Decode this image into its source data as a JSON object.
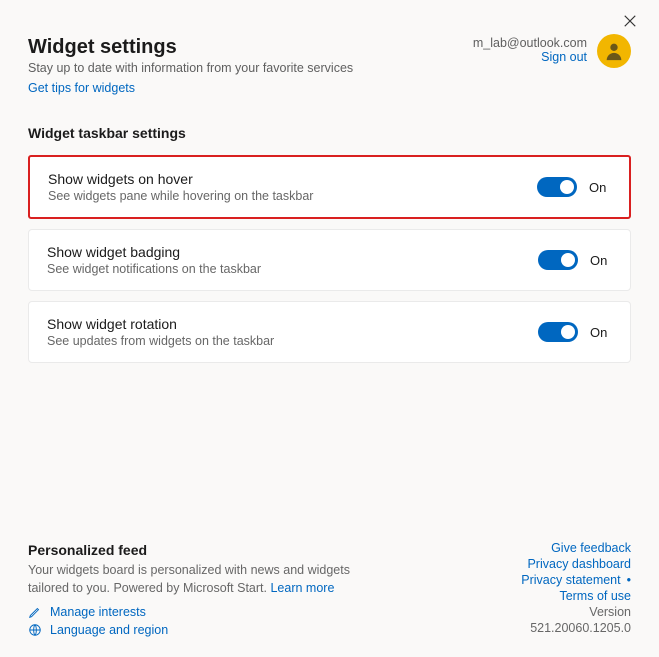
{
  "header": {
    "title": "Widget settings",
    "subtitle": "Stay up to date with information from your favorite services",
    "tips_link": "Get tips for widgets"
  },
  "account": {
    "email": "m_lab@outlook.com",
    "signout": "Sign out"
  },
  "section": {
    "title": "Widget taskbar settings",
    "items": [
      {
        "title": "Show widgets on hover",
        "desc": "See widgets pane while hovering on the taskbar",
        "state": "On"
      },
      {
        "title": "Show widget badging",
        "desc": "See widget notifications on the taskbar",
        "state": "On"
      },
      {
        "title": "Show widget rotation",
        "desc": "See updates from widgets on the taskbar",
        "state": "On"
      }
    ]
  },
  "footer": {
    "title": "Personalized feed",
    "desc": "Your widgets board is personalized with news and widgets tailored to you. Powered by Microsoft Start. ",
    "learn_more": "Learn more",
    "manage_interests": "Manage interests",
    "language_region": "Language and region"
  },
  "footer_right": {
    "feedback": "Give feedback",
    "privacy_dashboard": "Privacy dashboard",
    "privacy_statement": "Privacy statement",
    "terms": "Terms of use",
    "version_label": "Version",
    "version_num": "521.20060.1205.0"
  }
}
